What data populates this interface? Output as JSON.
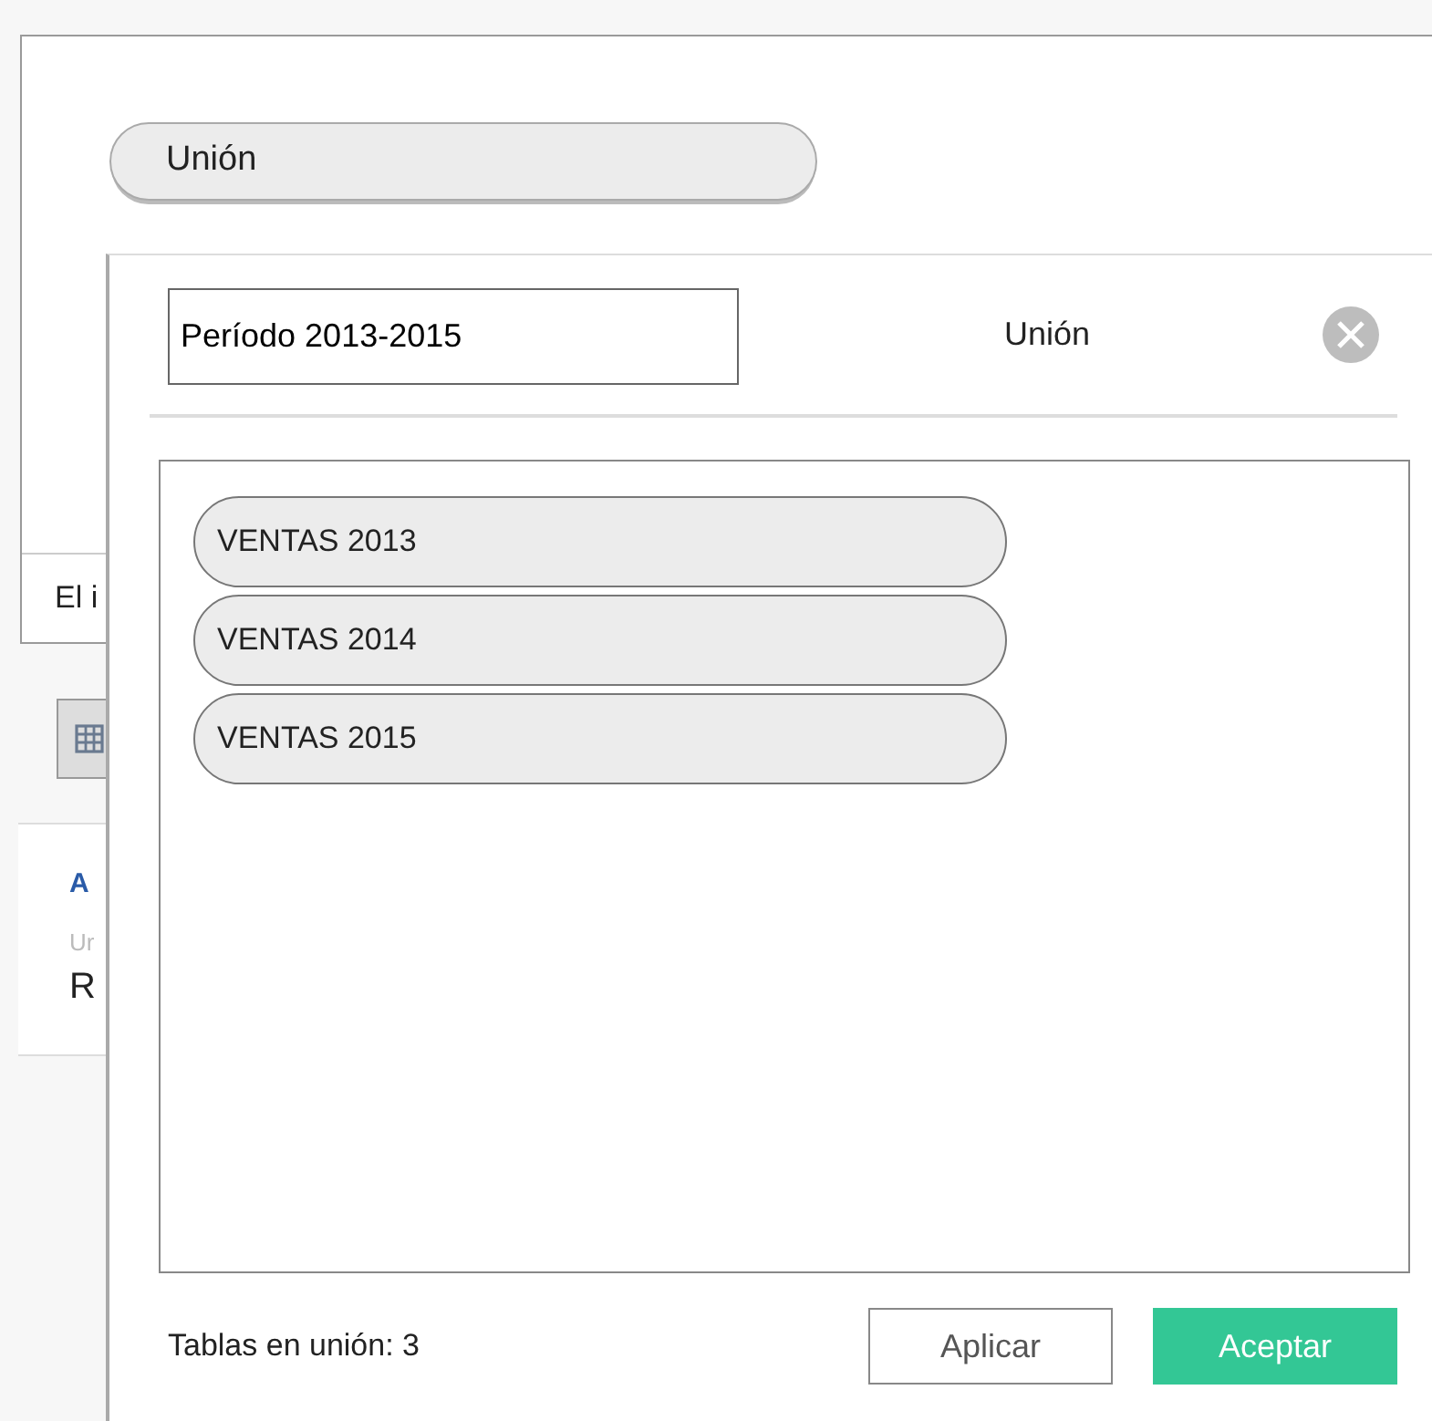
{
  "background": {
    "union_tab": "Unión",
    "notice": "El i",
    "card": {
      "title": "A",
      "subtitle": "Ur",
      "value": "R"
    }
  },
  "dialog": {
    "name_value": "Período 2013-2015",
    "title": "Unión",
    "tables": [
      {
        "label": "VENTAS 2013"
      },
      {
        "label": "VENTAS 2014"
      },
      {
        "label": "VENTAS 2015"
      }
    ],
    "count_text": "Tablas en unión: 3",
    "buttons": [
      {
        "label": "Aplicar",
        "kind": "secondary"
      },
      {
        "label": "Aceptar",
        "kind": "primary"
      }
    ]
  }
}
